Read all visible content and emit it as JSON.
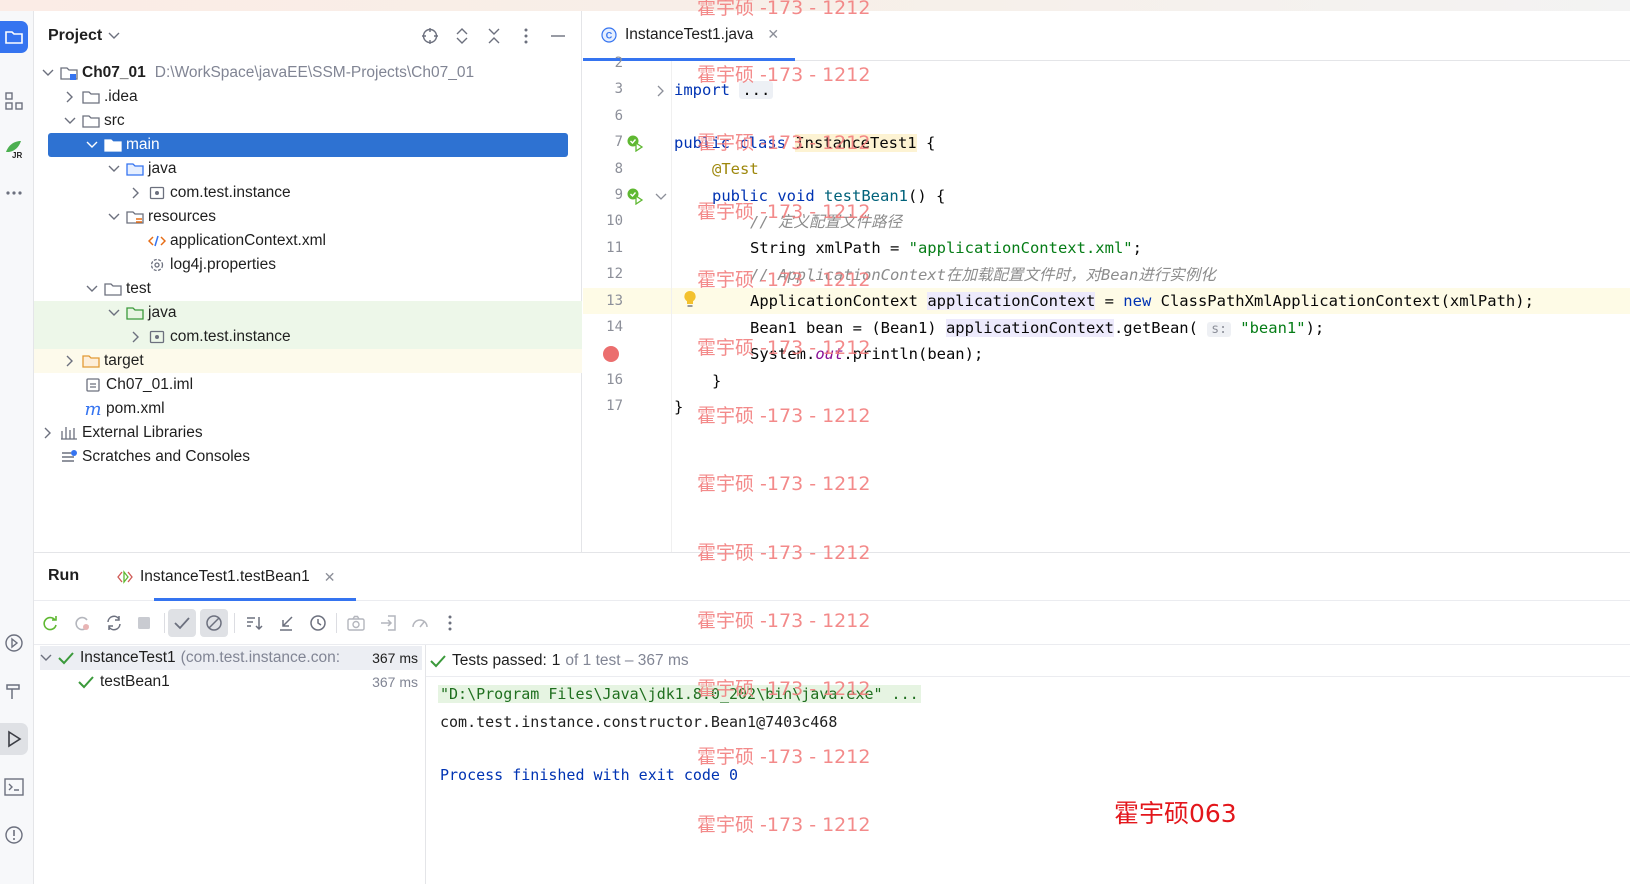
{
  "project_panel": {
    "title": "Project",
    "tree": [
      {
        "label": "Ch07_01",
        "path": "D:\\WorkSpace\\javaEE\\SSM-Projects\\Ch07_01"
      },
      {
        "label": ".idea"
      },
      {
        "label": "src"
      },
      {
        "label": "main"
      },
      {
        "label": "java"
      },
      {
        "label": "com.test.instance"
      },
      {
        "label": "resources"
      },
      {
        "label": "applicationContext.xml"
      },
      {
        "label": "log4j.properties"
      },
      {
        "label": "test"
      },
      {
        "label": "java"
      },
      {
        "label": "com.test.instance"
      },
      {
        "label": "target"
      },
      {
        "label": "Ch07_01.iml"
      },
      {
        "label": "pom.xml"
      },
      {
        "label": "External Libraries"
      },
      {
        "label": "Scratches and Consoles"
      }
    ]
  },
  "editor": {
    "tab_label": "InstanceTest1.java",
    "line_numbers": [
      "2",
      "3",
      "6",
      "7",
      "8",
      "9",
      "10",
      "11",
      "12",
      "13",
      "14",
      "16",
      "17"
    ],
    "code": {
      "import_kw": "import",
      "import_fold": "...",
      "class_kw": "public class",
      "class_name": "InstanceTest1",
      "class_brace": " {",
      "annotation": "@Test",
      "method_kw": "public void",
      "method_name": "testBean1",
      "method_sig": "() {",
      "comment1": "// 定义配置文件路径",
      "line11_a": "String xmlPath = ",
      "line11_str": "\"applicationContext.xml\"",
      "line11_b": ";",
      "comment2": "// ApplicationContext在加载配置文件时，对Bean进行实例化",
      "line13_a": "ApplicationContext ",
      "line13_var": "applicationContext",
      "line13_b": " = ",
      "line13_new": "new",
      "line13_c": " ClassPathXmlApplicationContext(xmlPath);",
      "line14_a": "Bean1 bean = (Bean1) ",
      "line14_var": "applicationContext",
      "line14_b": ".getBean( ",
      "line14_hint": "s:",
      "line14_str": " \"bean1\"",
      "line14_c": ");",
      "line15_a": "System.",
      "line15_out": "out",
      "line15_b": ".println(bean);",
      "method_close": "}",
      "class_close": "}"
    }
  },
  "run_panel": {
    "title": "Run",
    "tab_label": "InstanceTest1.testBean1",
    "tests": [
      {
        "label": "InstanceTest1",
        "detail": "(com.test.instance.con:",
        "time": "367 ms"
      },
      {
        "label": "testBean1",
        "time": "367 ms"
      }
    ],
    "status": {
      "passed_label": "Tests passed:",
      "passed_count": "1",
      "rest": "of 1 test – 367 ms"
    },
    "console": [
      "\"D:\\Program Files\\Java\\jdk1.8.0_202\\bin\\java.exe\" ...",
      "com.test.instance.constructor.Bean1@7403c468",
      "Process finished with exit code 0"
    ]
  },
  "watermarks": {
    "repeat_text": "霍宇硕 -173 - 1212",
    "signature": "霍宇硕063"
  },
  "colors": {
    "accent": "#3574f0",
    "selection": "#2e72d2",
    "keyword": "#0033b3",
    "string": "#067d17",
    "watermark": "#f27e7e",
    "signature": "#e3161b"
  }
}
